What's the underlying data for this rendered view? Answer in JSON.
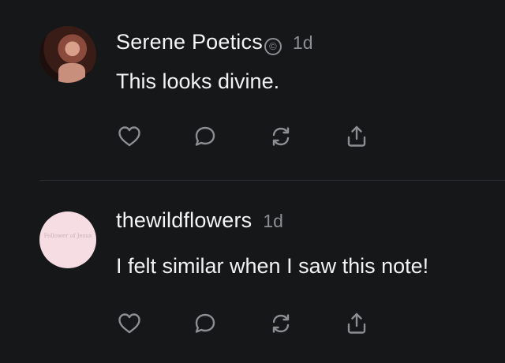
{
  "posts": [
    {
      "username": "Serene Poetics",
      "verified_symbol": "©",
      "timestamp": "1d",
      "text": "This looks divine.",
      "avatar": "photo-avatar"
    },
    {
      "username": "thewildflowers",
      "timestamp": "1d",
      "text": "I felt similar when I saw this note!",
      "avatar_text": "Follower of Jesus"
    }
  ],
  "action_icons": [
    "heart-icon",
    "comment-icon",
    "repost-icon",
    "share-icon"
  ],
  "colors": {
    "background": "#161719",
    "text_primary": "#f2f2f2",
    "text_secondary": "#8d8d92",
    "divider": "#2c2d31",
    "avatar_pink": "#f6dce3"
  }
}
